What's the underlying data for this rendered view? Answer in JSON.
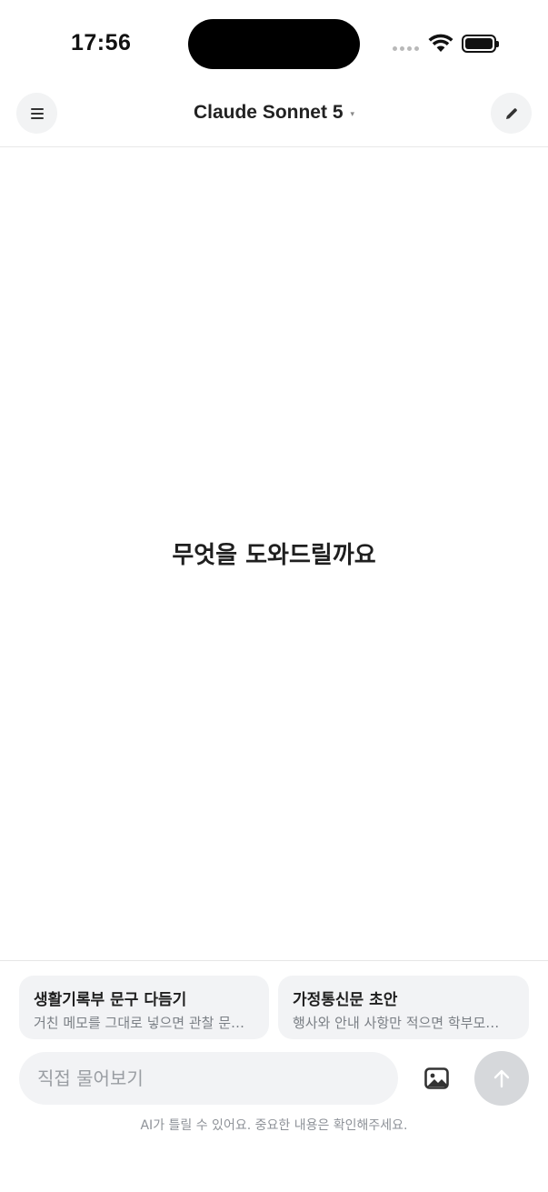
{
  "status_bar": {
    "time": "17:56",
    "icons": [
      "cellular-signal-icon",
      "wifi-icon",
      "battery-icon"
    ]
  },
  "header": {
    "menu_icon": "hamburger-menu-icon",
    "model_name": "Claude Sonnet 5",
    "caret": "▾",
    "new_chat_icon": "pencil-icon"
  },
  "main": {
    "greeting": "무엇을 도와드릴까요"
  },
  "suggestions": [
    {
      "title": "생활기록부 문구 다듬기",
      "subtitle": "거친 메모를 그대로 넣으면 관찰 문…"
    },
    {
      "title": "가정통신문 초안",
      "subtitle": "행사와 안내 사항만 적으면 학부모…"
    }
  ],
  "composer": {
    "placeholder": "직접 물어보기",
    "image_icon": "image-upload-icon",
    "send_icon": "arrow-up-icon"
  },
  "footer": {
    "disclaimer": "AI가 틀릴 수 있어요. 중요한 내용은 확인해주세요."
  },
  "colors": {
    "button_bg": "#f2f3f4",
    "send_disabled": "#d6d8db",
    "muted_text": "#8e9298"
  }
}
